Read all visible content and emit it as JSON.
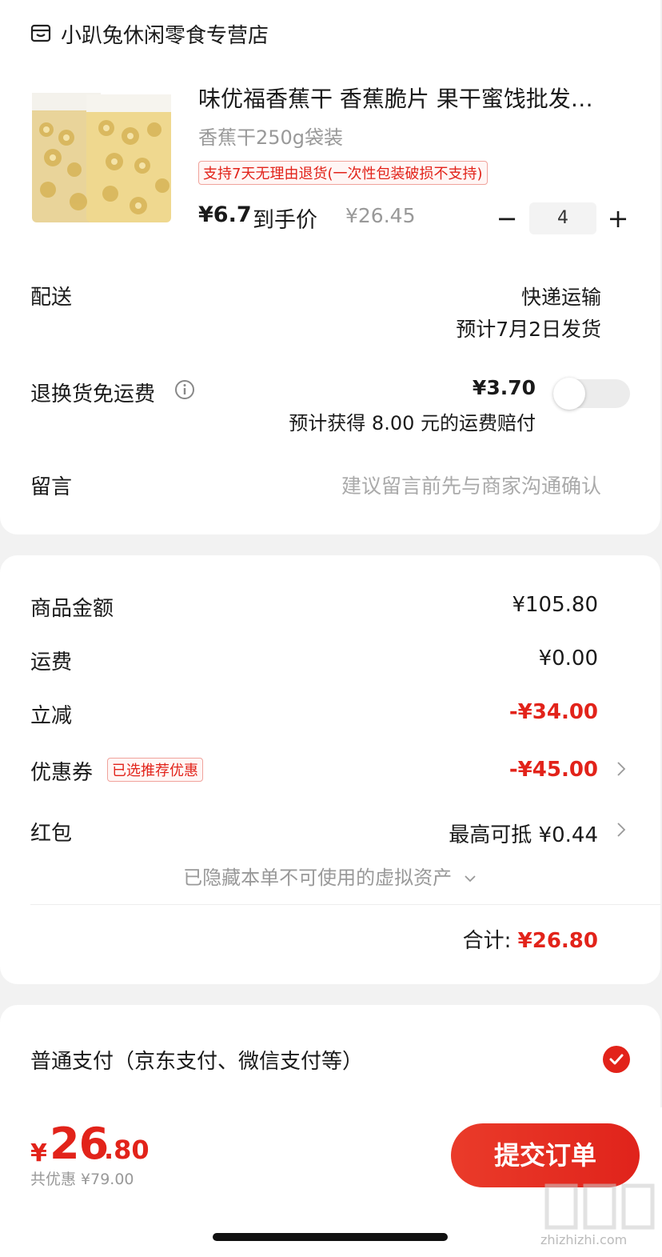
{
  "store": {
    "name": "小趴兔休闲零食专营店",
    "icon": "store-icon"
  },
  "product": {
    "title": "味优福香蕉干 香蕉脆片 果干蜜饯批发…",
    "spec": "香蕉干250g袋装",
    "return_tag": "支持7天无理由退货(一次性包装破损不支持)",
    "price": "¥6.7",
    "price_suffix": "到手价",
    "original_price": "¥26.45",
    "quantity": "4",
    "minus": "−",
    "plus": "+"
  },
  "delivery": {
    "label": "配送",
    "method": "快递运输",
    "eta": "预计7月2日发货"
  },
  "return_shipping": {
    "label": "退换货免运费",
    "price": "¥3.70",
    "note": "预计获得 8.00 元的运费赔付",
    "toggle_on": false
  },
  "message": {
    "label": "留言",
    "placeholder": "建议留言前先与商家沟通确认"
  },
  "costs": {
    "goods_label": "商品金额",
    "goods_value": "¥105.80",
    "shipping_label": "运费",
    "shipping_value": "¥0.00",
    "discount_label": "立减",
    "discount_value": "-¥34.00",
    "coupon_label": "优惠券",
    "coupon_tag": "已选推荐优惠",
    "coupon_value": "-¥45.00",
    "redpacket_label": "红包",
    "redpacket_value": "最高可抵 ¥0.44",
    "hidden_assets": "已隐藏本单不可使用的虚拟资产",
    "total_label": "合计:",
    "total_value": "¥26.80"
  },
  "payment": {
    "label": "普通支付（京东支付、微信支付等）",
    "selected": true
  },
  "bottom": {
    "yen": "¥",
    "total_int": "26",
    "total_dec": ".80",
    "saved": "共优惠 ¥79.00",
    "submit": "提交订单"
  },
  "watermark": "zhizhizhi.com",
  "colors": {
    "accent": "#e2231a"
  }
}
